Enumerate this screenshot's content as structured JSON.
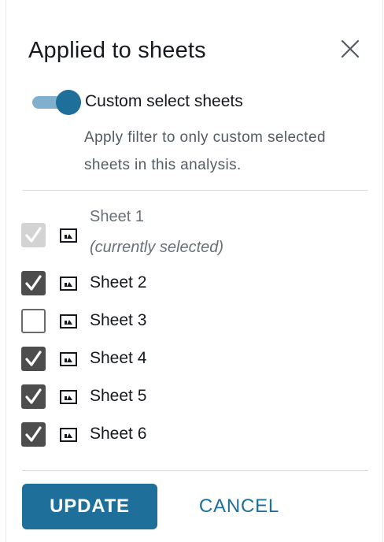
{
  "panel": {
    "title": "Applied to sheets",
    "close_icon": "close-icon"
  },
  "toggle": {
    "on": true,
    "label": "Custom select sheets",
    "description": "Apply filter to only custom selected sheets in this analysis."
  },
  "sheets": [
    {
      "name": "Sheet 1",
      "note": "(currently selected)",
      "checked": true,
      "disabled": true,
      "icon": "sheet-icon"
    },
    {
      "name": "Sheet 2",
      "note": "",
      "checked": true,
      "disabled": false,
      "icon": "sheet-icon"
    },
    {
      "name": "Sheet 3",
      "note": "",
      "checked": false,
      "disabled": false,
      "icon": "sheet-icon"
    },
    {
      "name": "Sheet 4",
      "note": "",
      "checked": true,
      "disabled": false,
      "icon": "sheet-icon"
    },
    {
      "name": "Sheet 5",
      "note": "",
      "checked": true,
      "disabled": false,
      "icon": "sheet-icon"
    },
    {
      "name": "Sheet 6",
      "note": "",
      "checked": true,
      "disabled": false,
      "icon": "sheet-icon"
    }
  ],
  "actions": {
    "update_label": "UPDATE",
    "cancel_label": "CANCEL"
  },
  "colors": {
    "accent": "#1f6f9b",
    "toggle_track": "#7fb1ce",
    "checkbox_checked": "#4d4d4d",
    "checkbox_disabled": "#d3d3d3"
  }
}
